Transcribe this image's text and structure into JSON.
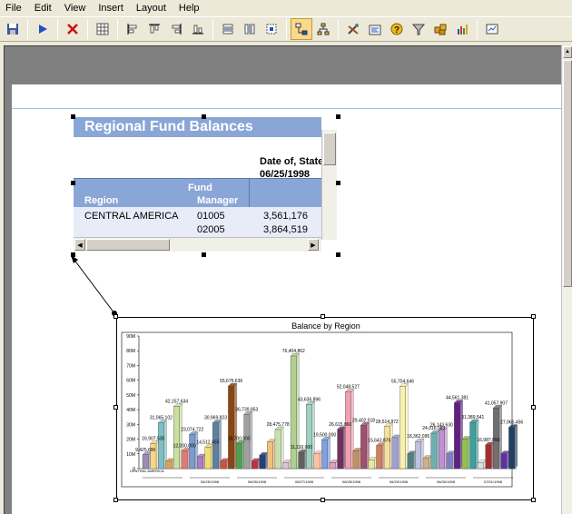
{
  "menu": {
    "items": [
      "File",
      "Edit",
      "View",
      "Insert",
      "Layout",
      "Help"
    ]
  },
  "toolbar": {
    "buttons": [
      "save-icon",
      "run-icon",
      "delete-icon",
      "grid-icon",
      "align-left-icon",
      "align-top-icon",
      "align-right-icon",
      "align-bottom-icon",
      "same-width-icon",
      "same-height-icon",
      "same-size-icon",
      "connect-objects-icon",
      "tree-layout-icon",
      "tools-icon",
      "properties-icon",
      "help-icon",
      "filter-icon",
      "objects-icon",
      "chart-wizard-icon",
      "preview-icon"
    ]
  },
  "table": {
    "title": "Regional Fund Balances",
    "date_label": "Date of, State",
    "date_value": "06/25/1998",
    "headers": {
      "region": "Region",
      "fund_manager_1": "Fund",
      "fund_manager_2": "Manager"
    },
    "rows": [
      {
        "region": "CENTRAL AMERICA",
        "manager": "01005",
        "balance": "3,561,176"
      },
      {
        "region": "",
        "manager": "02005",
        "balance": "3,864,519"
      }
    ]
  },
  "chart_data": {
    "type": "bar",
    "title": "Balance by Region",
    "y_ticks": [
      "0",
      "10M",
      "20M",
      "30M",
      "40M",
      "50M",
      "60M",
      "70M",
      "80M",
      "90M"
    ],
    "ylim": [
      0,
      90000000
    ],
    "values": [
      9.4,
      16.9,
      31.0,
      5.0,
      42.2,
      12.0,
      23.1,
      8.0,
      14.5,
      31.0,
      5.0,
      56.0,
      17.0,
      36.7,
      5.0,
      9.0,
      18.0,
      26.5,
      4.0,
      76.4,
      11.0,
      43.6,
      10.0,
      19.5,
      4.0,
      26.6,
      52.0,
      12.0,
      29.4,
      6.0,
      15.6,
      28.5,
      21.0,
      55.7,
      10.0,
      18.4,
      7.0,
      24.0,
      26.1,
      10.0,
      44.6,
      20.0,
      31.4,
      4.0,
      16.0,
      41.1,
      10.0,
      28.0
    ],
    "data_labels": [
      "9,425,690",
      "16,907,535",
      "31,065,102",
      "",
      "42,157,634",
      "12,000,000",
      "23,074,722",
      "",
      "14,512,455",
      "30,969,823",
      "",
      "55,675,636",
      "16,700,000",
      "36,739,853",
      "",
      "",
      "",
      "28,475,778",
      "",
      "76,404,862",
      "11,110,000",
      "43,636,896",
      "",
      "19,500,000",
      "",
      "26,615,860",
      "52,048,527",
      "",
      "29,402,518",
      "",
      "15,643,876",
      "28,514,872",
      "",
      "55,704,646",
      "",
      "18,362,095",
      "",
      "24,016,983",
      "26,143,630",
      "",
      "44,561,381",
      "",
      "31,389,541",
      "",
      "16,987,890",
      "41,057,907",
      "",
      "27,965,456"
    ],
    "colors": [
      "#9c8bb5",
      "#f5d78a",
      "#7fbfc4",
      "#d9a05a",
      "#c8e0a0",
      "#e07a7a",
      "#7a9ad0",
      "#b07cc0",
      "#f0e070",
      "#6080a0",
      "#d05040",
      "#8b4513",
      "#50a050",
      "#a0a0a0",
      "#c03040",
      "#204080",
      "#f0c080",
      "#c8e0b0",
      "#e0c0e0",
      "#b0d090",
      "#606060",
      "#a0d0c0",
      "#ffc0a0",
      "#80a0e0",
      "#e0a0c0",
      "#703060",
      "#f0a0b0",
      "#c09060",
      "#a05070",
      "#e8e8a0",
      "#d08060",
      "#f5e0a0",
      "#a0a0d0",
      "#f8f0b0",
      "#508080",
      "#c0c0e0",
      "#d0b080",
      "#70b0b0",
      "#c090d0",
      "#8080c0",
      "#602080",
      "#90c050",
      "#40a0a0",
      "#e0e0e0",
      "#a03030",
      "#707070",
      "#6030a0",
      "#204060"
    ],
    "x_labels": [
      "CENTRAL AMERICA",
      "06/25/1998",
      "06/26/1998",
      "06/27/1998",
      "06/28/1998",
      "06/29/1998",
      "06/30/1998",
      "07/01/1998"
    ]
  }
}
